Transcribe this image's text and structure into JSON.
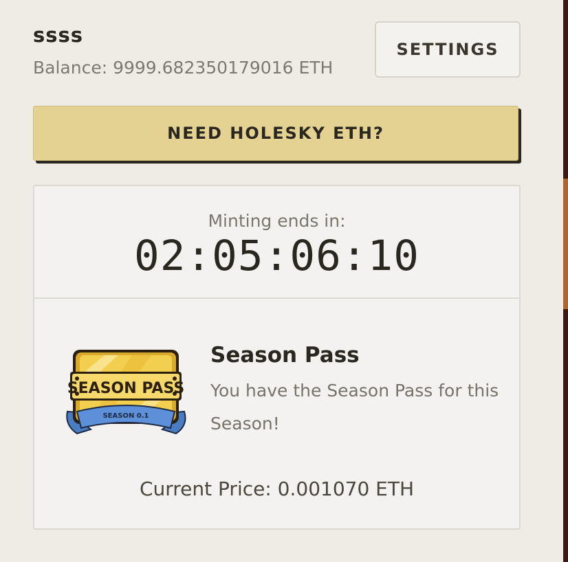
{
  "header": {
    "username": "ssss",
    "balance": "Balance: 9999.682350179016 ETH",
    "settings_label": "SETTINGS"
  },
  "faucet": {
    "label": "NEED HOLESKY ETH?",
    "color": "#e4d292"
  },
  "mint": {
    "label": "Minting ends in:",
    "countdown": "02:05:06:10"
  },
  "season_pass": {
    "title": "Season Pass",
    "description": "You have the Season Pass for this Season!",
    "icon": "season-pass-ticket-icon",
    "icon_text": "SEASON PASS",
    "icon_subtext": "SEASON 0.1",
    "current_price": "Current Price: 0.001070 ETH"
  },
  "colors": {
    "background": "#efece6",
    "card": "#f3f2f0",
    "accent_yellow": "#e4d292"
  }
}
